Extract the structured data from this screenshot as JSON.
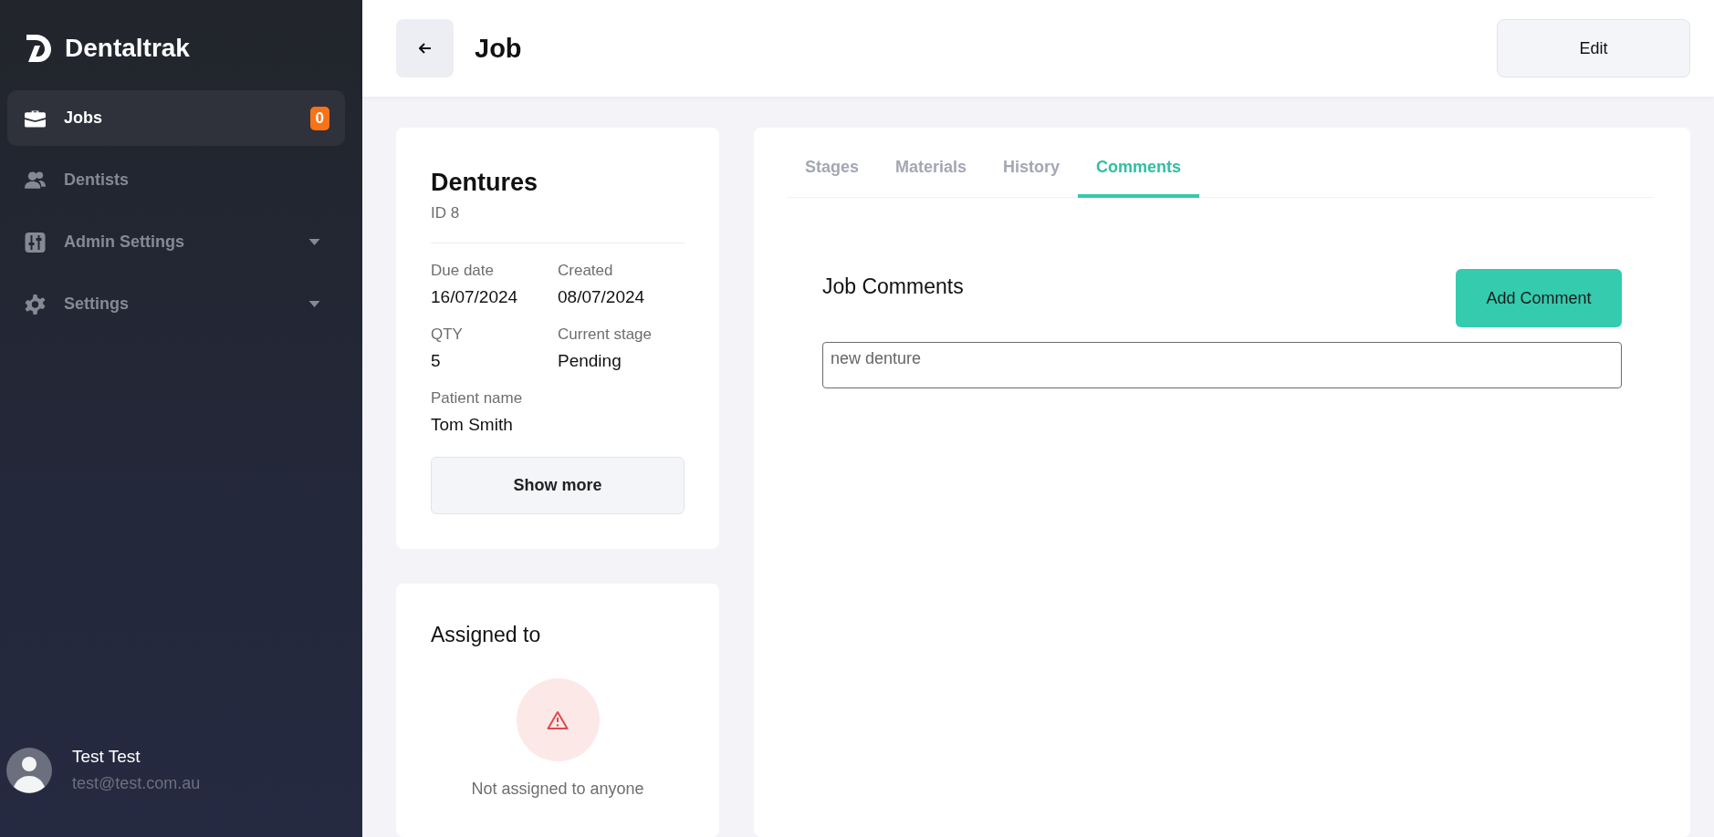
{
  "app": {
    "name": "Dentaltrak"
  },
  "sidebar": {
    "items": [
      {
        "label": "Jobs",
        "kind": "link",
        "selected": true,
        "badge": "0"
      },
      {
        "label": "Dentists",
        "kind": "link",
        "selected": false
      },
      {
        "label": "Admin Settings",
        "kind": "group",
        "selected": false
      },
      {
        "label": "Settings",
        "kind": "group",
        "selected": false
      }
    ],
    "user": {
      "name": "Test Test",
      "email": "test@test.com.au"
    }
  },
  "header": {
    "title": "Job",
    "edit_button": "Edit"
  },
  "job": {
    "title": "Dentures",
    "id": "ID 8",
    "fields": [
      {
        "label": "Due date",
        "value": "16/07/2024"
      },
      {
        "label": "Created",
        "value": "08/07/2024"
      },
      {
        "label": "QTY",
        "value": "5"
      },
      {
        "label": "Current stage",
        "value": "Pending"
      },
      {
        "label": "Patient name",
        "value": "Tom Smith"
      }
    ],
    "show_more": "Show more"
  },
  "assigned": {
    "title": "Assigned to",
    "empty_text": "Not assigned to anyone"
  },
  "tabs": [
    {
      "label": "Stages",
      "selected": false
    },
    {
      "label": "Materials",
      "selected": false
    },
    {
      "label": "History",
      "selected": false
    },
    {
      "label": "Comments",
      "selected": true
    }
  ],
  "comments": {
    "title": "Job Comments",
    "add_button": "Add Comment",
    "input_value": "new denture"
  }
}
